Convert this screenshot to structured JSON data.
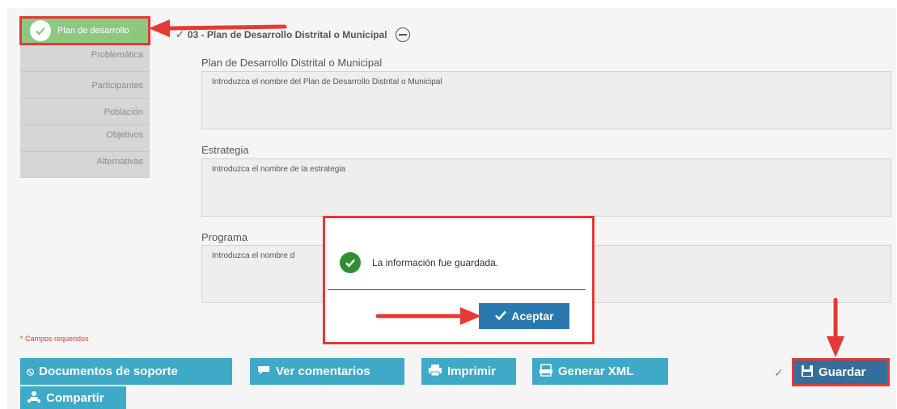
{
  "sidebar": {
    "items": [
      {
        "label": "Plan de desarrollo",
        "active": true
      },
      {
        "label": "Problemática"
      },
      {
        "label": "Participantes"
      },
      {
        "label": "Población"
      },
      {
        "label": "Objetivos"
      },
      {
        "label": "Alternativas"
      }
    ]
  },
  "section": {
    "title": "03 - Plan de Desarrollo Distrital o Municipal"
  },
  "fields": [
    {
      "label": "Plan de Desarrollo Distrital o Municipal",
      "placeholder": "Introduzca el nombre del Plan de Desarrollo Distrital o Municipal"
    },
    {
      "label": "Estrategia",
      "placeholder": "Introduzca el nombre de la estrategia"
    },
    {
      "label": "Programa",
      "placeholder": "Introduzca el nombre d"
    }
  ],
  "required_note": "* Campos requeridos",
  "buttons": {
    "documentos": "Documentos de soporte",
    "comentarios": "Ver comentarios",
    "imprimir": "Imprimir",
    "xml": "Generar XML",
    "guardar": "Guardar",
    "compartir": "Compartir"
  },
  "modal": {
    "message": "La información fue guardada.",
    "accept": "Aceptar"
  },
  "colors": {
    "accent": "#3fa9c8",
    "save": "#346e9a",
    "success": "#8dc881",
    "annotation": "#e53935"
  },
  "icons": {
    "check": "check-icon",
    "paperclip": "paperclip-icon",
    "comment": "comment-icon",
    "print": "printer-icon",
    "xml": "xml-file-icon",
    "save": "floppy-icon",
    "share": "share-users-icon"
  }
}
